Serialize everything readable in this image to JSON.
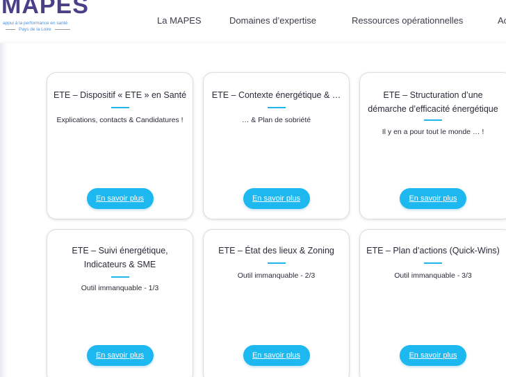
{
  "header": {
    "logo": {
      "wordmark": "MAPES",
      "tagline": "appui à la performance en santé",
      "region": "Pays de la Loire"
    },
    "nav": [
      {
        "label": "La MAPES"
      },
      {
        "label": "Domaines d’expertise"
      },
      {
        "label": "Ressources opérationnelles"
      },
      {
        "label": "Ac"
      }
    ]
  },
  "cards": [
    {
      "title": "ETE – Dispositif « ETE » en Santé",
      "description": "Explications, contacts & Candidatures !",
      "button": "En savoir plus"
    },
    {
      "title": "ETE – Contexte énergétique & …",
      "description": "… & Plan de sobriété",
      "button": "En savoir plus"
    },
    {
      "title": "ETE – Structuration d’une démarche d’efficacité énergétique",
      "description": "Il y en a pour tout le monde … !",
      "button": "En savoir plus"
    },
    {
      "title": "ETE – Suivi énergétique, Indicateurs & SME",
      "description": "Outil immanquable - 1/3",
      "button": "En savoir plus"
    },
    {
      "title": "ETE – État des lieux & Zoning",
      "description": "Outil immanquable - 2/3",
      "button": "En savoir plus"
    },
    {
      "title": "ETE – Plan d’actions (Quick-Wins)",
      "description": "Outil immanquable - 3/3",
      "button": "En savoir plus"
    }
  ],
  "colors": {
    "accent": "#1eb8f0",
    "brand": "#4b3f87",
    "card_border": "#dcdce2"
  }
}
